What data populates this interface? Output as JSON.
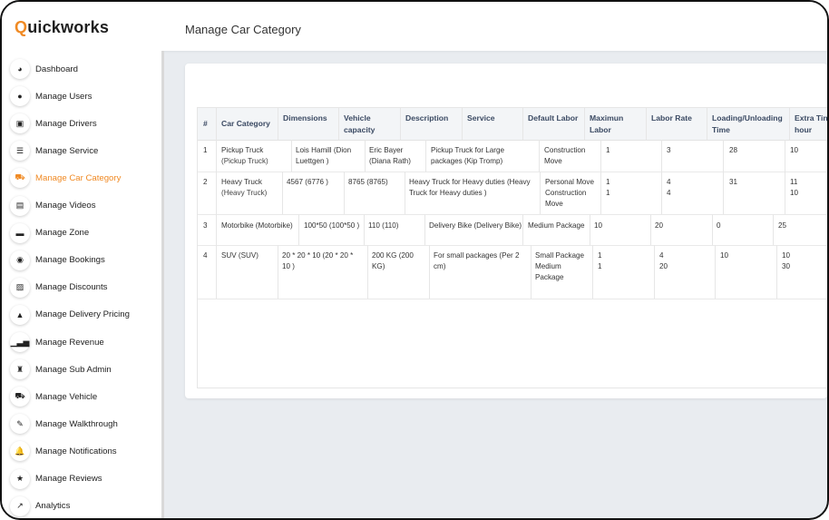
{
  "app": {
    "logo_first": "Q",
    "logo_rest": "uickworks"
  },
  "header": {
    "title": "Manage Car Category"
  },
  "sidebar": {
    "items": [
      {
        "label": "Dashboard",
        "icon": "dashboard-icon",
        "glyph": "◕"
      },
      {
        "label": "Manage Users",
        "icon": "user-icon",
        "glyph": "●"
      },
      {
        "label": "Manage Drivers",
        "icon": "driver-icon",
        "glyph": "▣"
      },
      {
        "label": "Manage Service",
        "icon": "service-icon",
        "glyph": "☰"
      },
      {
        "label": "Manage Car Category",
        "icon": "car-icon",
        "glyph": "⛟",
        "active": true
      },
      {
        "label": "Manage Videos",
        "icon": "video-icon",
        "glyph": "▤"
      },
      {
        "label": "Manage Zone",
        "icon": "zone-icon",
        "glyph": "▬"
      },
      {
        "label": "Manage Bookings",
        "icon": "booking-icon",
        "glyph": "◉"
      },
      {
        "label": "Manage Discounts",
        "icon": "discount-icon",
        "glyph": "▨"
      },
      {
        "label": "Manage Delivery Pricing",
        "icon": "pricing-icon",
        "glyph": "▲"
      },
      {
        "label": "Manage Revenue",
        "icon": "revenue-icon",
        "glyph": "▁▃▅"
      },
      {
        "label": "Manage Sub Admin",
        "icon": "sub-admin-icon",
        "glyph": "♜"
      },
      {
        "label": "Manage Vehicle",
        "icon": "vehicle-icon",
        "glyph": "⛟"
      },
      {
        "label": "Manage Walkthrough",
        "icon": "walkthrough-icon",
        "glyph": "✎"
      },
      {
        "label": "Manage Notifications",
        "icon": "bell-icon",
        "glyph": "🔔"
      },
      {
        "label": "Manage Reviews",
        "icon": "star-icon",
        "glyph": "★"
      },
      {
        "label": "Analytics",
        "icon": "analytics-icon",
        "glyph": "↗"
      }
    ]
  },
  "table": {
    "headers": [
      "#",
      "Car Category",
      "Dimensions",
      "Vehicle capacity",
      "Description",
      "Service",
      "Default Labor",
      "Maximun Labor",
      "Labor Rate",
      "Loading/Unloading Time",
      "Extra Tin hour"
    ],
    "rows": [
      {
        "num": "1",
        "category": "Pickup Truck",
        "category_sub": "(Pickup Truck)",
        "dimensions": "Lois Hamill (Dion Luettgen )",
        "capacity": "Eric Bayer (Diana Rath)",
        "description": "Pickup Truck for Large packages (Kip Tromp)",
        "service": "Construction Move",
        "max_labor": "1",
        "labor_rate": "3",
        "loading": "28",
        "extra": "10"
      },
      {
        "num": "2",
        "category": "Heavy Truck",
        "category_sub": "(Heavy Truck)",
        "dimensions": "4567 (6776 )",
        "capacity": "8765 (8765)",
        "description": "Heavy Truck for Heavy duties (Heavy Truck for Heavy duties )",
        "service": "Personal Move Construction Move",
        "max_labor": "1\n1",
        "labor_rate": "4\n4",
        "loading": "31",
        "extra": "11\n10"
      },
      {
        "num": "3",
        "category": "Motorbike (Motorbike)",
        "dimensions": "100*50 (100*50 )",
        "capacity": "110 (110)",
        "description": "Delivery Bike (Delivery Bike)",
        "service": "Medium Package",
        "max_labor": "10",
        "labor_rate": "20",
        "loading": "0",
        "extra": "25"
      },
      {
        "num": "4",
        "category": "SUV (SUV)",
        "dimensions": "20 * 20 * 10 (20 * 20 * 10 )",
        "capacity": "200 KG (200 KG)",
        "description": "For small packages (Per 2 cm)",
        "service": "Small Package Medium Package",
        "max_labor": "1\n1",
        "labor_rate": "4\n20",
        "loading": "10",
        "extra": "10\n30"
      }
    ]
  },
  "colors": {
    "accent": "#f08a24",
    "header_text": "#3b4a63",
    "background": "#e9ecf0"
  }
}
